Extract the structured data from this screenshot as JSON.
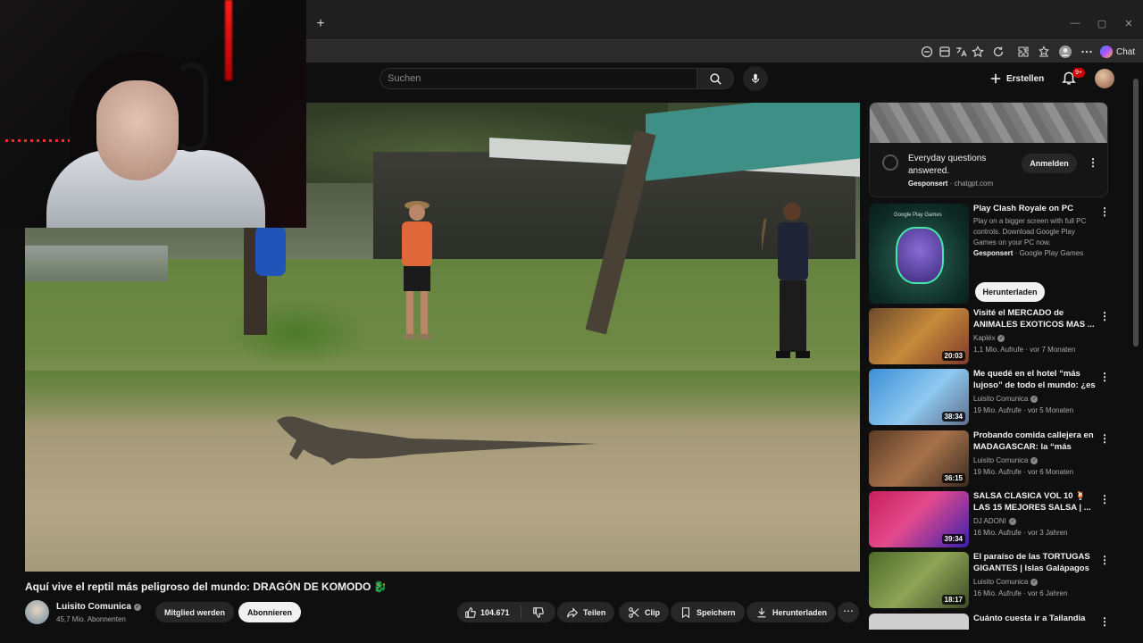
{
  "browser": {
    "new_tab": "+",
    "chat_label": "Chat"
  },
  "header": {
    "search_placeholder": "Suchen",
    "create_label": "Erstellen",
    "notification_count": "9+"
  },
  "video": {
    "title": "Aquí vive el reptil más peligroso del mundo: DRAGÓN DE KOMODO",
    "title_emoji": "🐉",
    "channel": "Luisito Comunica",
    "subscribers": "45,7 Mio. Abonnenten",
    "member_label": "Mitglied werden",
    "subscribe_label": "Abonnieren",
    "likes": "104.671",
    "share_label": "Teilen",
    "clip_label": "Clip",
    "save_label": "Speichern",
    "download_label": "Herunterladen",
    "more_label": "⋯"
  },
  "ad": {
    "title": "Everyday questions answered.",
    "sponsored": "Gesponsert",
    "domain": "chatgpt.com",
    "button": "Anmelden"
  },
  "promo": {
    "title": "Play Clash Royale on PC",
    "description": "Play on a bigger screen with full PC controls. Download Google Play Games on your PC now.",
    "sponsored": "Gesponsert",
    "advertiser": "Google Play Games",
    "button": "Herunterladen",
    "thumb_text": "Google Play Games"
  },
  "recommendations": [
    {
      "title": "Visité el MERCADO de ANIMALES EXOTICOS MAS ...",
      "channel": "Kapléx",
      "meta": "1,1 Mio. Aufrufe · vor 7 Monaten",
      "duration": "20:03"
    },
    {
      "title": "Me quedé en el hotel “más lujoso” de todo el mundo: ¿es ...",
      "channel": "Luisito Comunica",
      "meta": "19 Mio. Aufrufe · vor 5 Monaten",
      "duration": "38:34"
    },
    {
      "title": "Probando comida callejera en MADAGASCAR: la “más barata...",
      "channel": "Luisito Comunica",
      "meta": "19 Mio. Aufrufe · vor 6 Monaten",
      "duration": "36:15"
    },
    {
      "title": "SALSA CLASICA VOL 10 🍹 LAS 15 MEJORES SALSA | ...",
      "channel": "DJ ADONI",
      "meta": "16 Mio. Aufrufe · vor 3 Jahren",
      "duration": "39:34"
    },
    {
      "title": "El paraíso de las TORTUGAS GIGANTES | Islas Galápagos 🐢",
      "channel": "Luisito Comunica",
      "meta": "16 Mio. Aufrufe · vor 6 Jahren",
      "duration": "18:17"
    },
    {
      "title": "Cuánto cuesta ir a Tailandia",
      "channel": "",
      "meta": "",
      "duration": ""
    }
  ]
}
